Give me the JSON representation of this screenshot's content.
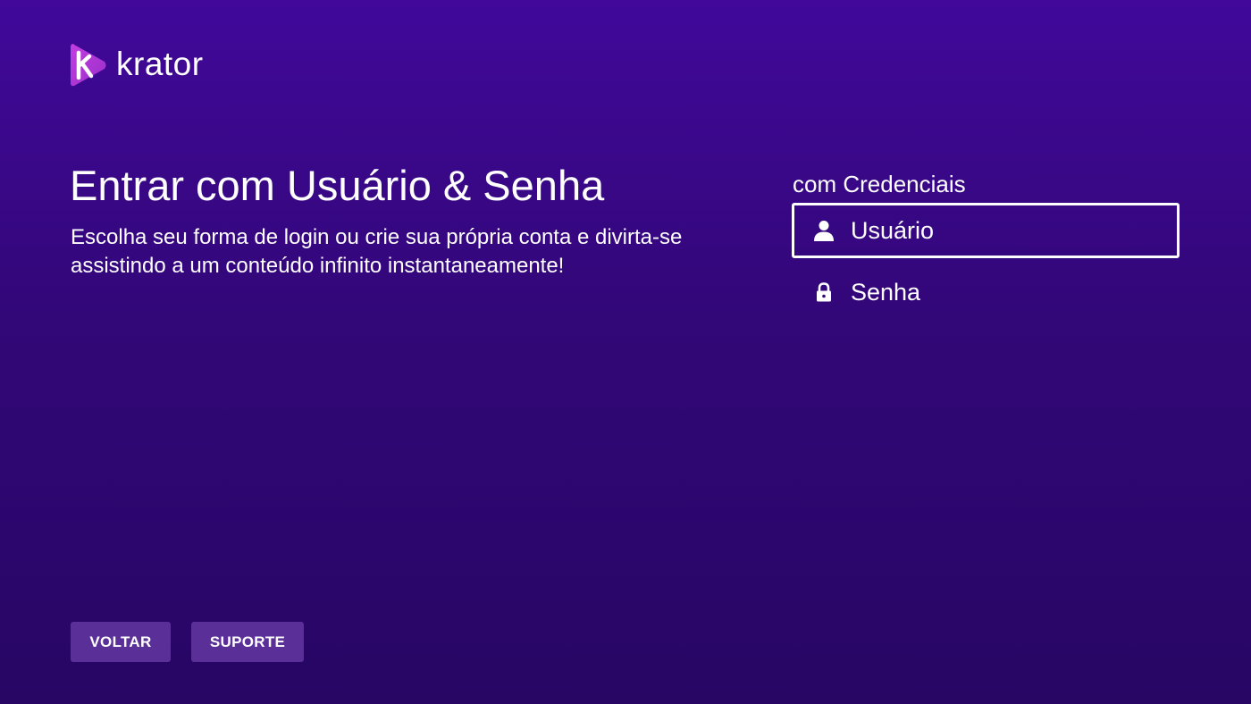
{
  "brand": {
    "name": "krator",
    "accent_color": "#b23fd6"
  },
  "login": {
    "title": "Entrar com Usuário & Senha",
    "subtitle": "Escolha seu forma de login ou crie sua própria conta e divirta-se assistindo a um conteúdo infinito instantaneamente!"
  },
  "credentials": {
    "label": "com Credenciais",
    "fields": [
      {
        "label": "Usuário",
        "icon": "user-icon",
        "focused": true
      },
      {
        "label": "Senha",
        "icon": "lock-icon",
        "focused": false
      }
    ]
  },
  "footer": {
    "back_label": "VOLTAR",
    "support_label": "SUPORTE"
  },
  "colors": {
    "background_top": "#41089a",
    "background_bottom": "#270664",
    "button_bg": "#5a2f98"
  }
}
